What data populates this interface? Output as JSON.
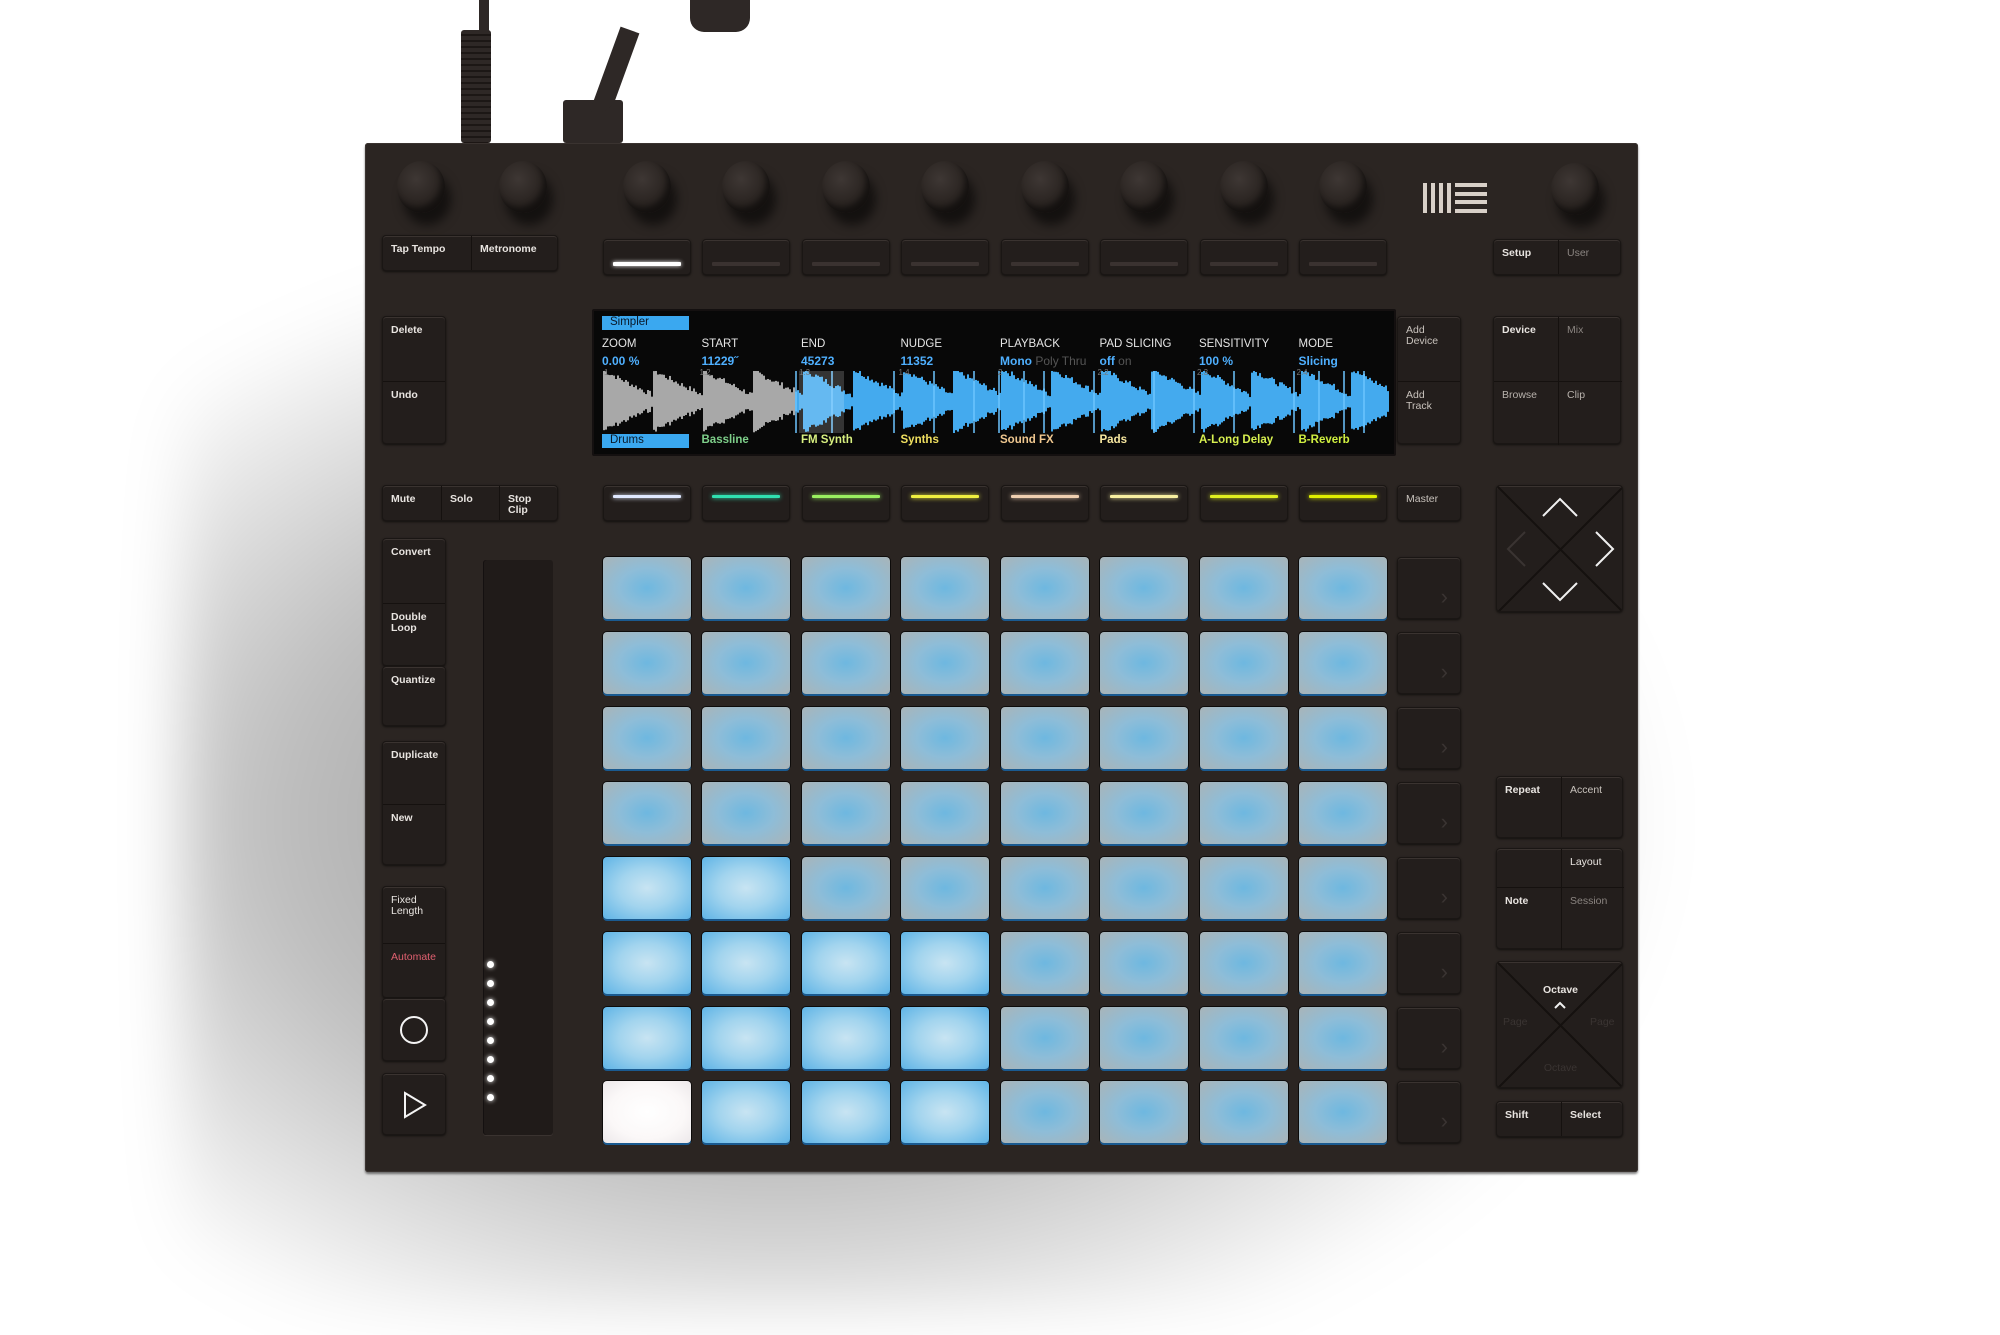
{
  "device": {
    "brand_logo": "ableton-logo",
    "colors": {
      "body": "#2b2522",
      "display_value": "#4fb0ff",
      "pad_blue": "#6eb8e0",
      "pad_bright": "#a2d4ee",
      "pad_white": "#ffffff",
      "automate": "#e06070"
    }
  },
  "top_left": {
    "tap_tempo": "Tap Tempo",
    "metronome": "Metronome"
  },
  "top_right": {
    "setup": "Setup",
    "user": "User"
  },
  "left_column": {
    "delete": "Delete",
    "undo": "Undo",
    "mute": "Mute",
    "solo": "Solo",
    "stop_clip": "Stop\nClip",
    "convert": "Convert",
    "double_loop": "Double\nLoop",
    "quantize": "Quantize",
    "duplicate": "Duplicate",
    "new": "New",
    "fixed_length": "Fixed\nLength",
    "automate": "Automate",
    "record_icon": "record-circle-icon",
    "play_icon": "play-triangle-icon"
  },
  "right_column": {
    "add_device": "Add\nDevice",
    "add_track": "Add\nTrack",
    "device": "Device",
    "mix": "Mix",
    "browse": "Browse",
    "clip": "Clip",
    "master": "Master",
    "repeat": "Repeat",
    "accent": "Accent",
    "layout": "Layout",
    "note": "Note",
    "session": "Session",
    "octave_up": "Octave",
    "octave_down": "Octave",
    "page_left": "Page",
    "page_right": "Page",
    "shift": "Shift",
    "select": "Select"
  },
  "upper_buttons": {
    "active_index": 0,
    "led_colors": [
      "#ffffff",
      "#3a3230",
      "#3a3230",
      "#3a3230",
      "#3a3230",
      "#3a3230",
      "#3a3230",
      "#3a3230"
    ]
  },
  "track_buttons": {
    "led_colors": [
      "#dfe8ff",
      "#30e0b0",
      "#9af060",
      "#f0f040",
      "#f0d0b0",
      "#f8f0a0",
      "#e0f020",
      "#e0f000"
    ]
  },
  "display": {
    "device_tab": "Simpler",
    "track_tab": "Drums",
    "params": [
      {
        "name": "ZOOM",
        "value": "0.00 %",
        "extra": ""
      },
      {
        "name": "START",
        "value": "11229˝",
        "extra": ""
      },
      {
        "name": "END",
        "value": "45273",
        "extra": ""
      },
      {
        "name": "NUDGE",
        "value": "11352",
        "extra": ""
      },
      {
        "name": "PLAYBACK",
        "value": "Mono",
        "extra": "Poly Thru"
      },
      {
        "name": "PAD SLICING",
        "value": "off",
        "extra": "on"
      },
      {
        "name": "SENSITIVITY",
        "value": "100 %",
        "extra": ""
      },
      {
        "name": "MODE",
        "value": "Slicing",
        "extra": ""
      }
    ],
    "markers": [
      "1",
      "1.2",
      "1.3",
      "1.4",
      "2",
      "2.2",
      "2.3",
      "2.4"
    ],
    "tracks": [
      {
        "name": "Drums",
        "color": "#0a1a2a"
      },
      {
        "name": "Bassline",
        "color": "#7ecf8a"
      },
      {
        "name": "FM Synth",
        "color": "#d8f080"
      },
      {
        "name": "Synths",
        "color": "#f0e060"
      },
      {
        "name": "Sound FX",
        "color": "#f0c890"
      },
      {
        "name": "Pads",
        "color": "#f8e8a0"
      },
      {
        "name": "A-Long Delay",
        "color": "#d8f050"
      },
      {
        "name": "B-Reverb",
        "color": "#d0f040"
      }
    ]
  },
  "pads": {
    "rows": [
      [
        "A",
        "A",
        "A",
        "A",
        "A",
        "A",
        "A",
        "A"
      ],
      [
        "A",
        "A",
        "A",
        "A",
        "A",
        "A",
        "A",
        "A"
      ],
      [
        "A",
        "A",
        "A",
        "A",
        "A",
        "A",
        "A",
        "A"
      ],
      [
        "A",
        "A",
        "A",
        "A",
        "A",
        "A",
        "A",
        "A"
      ],
      [
        "B",
        "B",
        "A",
        "A",
        "A",
        "A",
        "A",
        "A"
      ],
      [
        "B",
        "B",
        "B",
        "B",
        "A",
        "A",
        "A",
        "A"
      ],
      [
        "B",
        "B",
        "B",
        "B",
        "A",
        "A",
        "A",
        "A"
      ],
      [
        "W",
        "B",
        "B",
        "B",
        "A",
        "A",
        "A",
        "A"
      ]
    ]
  },
  "touch_strip": {
    "led_count": 8
  }
}
